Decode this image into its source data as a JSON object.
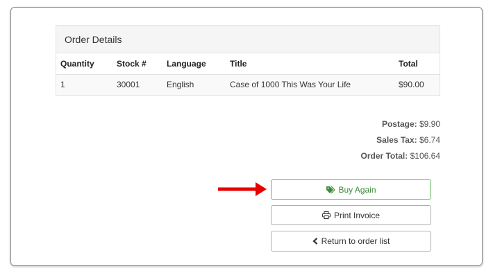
{
  "order_details": {
    "heading": "Order Details",
    "columns": [
      "Quantity",
      "Stock #",
      "Language",
      "Title",
      "Total"
    ],
    "rows": [
      [
        "1",
        "30001",
        "English",
        "Case of 1000 This Was Your Life",
        "$90.00"
      ]
    ]
  },
  "totals": {
    "postage_label": "Postage:",
    "postage_value": "$9.90",
    "tax_label": "Sales Tax:",
    "tax_value": "$6.74",
    "order_total_label": "Order Total:",
    "order_total_value": "$106.64"
  },
  "buttons": {
    "buy_again": "Buy Again",
    "print_invoice": "Print Invoice",
    "return_to_list": "Return to order list"
  },
  "colors": {
    "buy_again_border": "#5cb85c",
    "buy_again_text": "#3c8c3c",
    "arrow": "#e60000"
  },
  "icons": {
    "buy_again": "tags-icon",
    "print_invoice": "print-icon",
    "return_to_list": "chevron-left-icon",
    "annotation": "red-arrow-icon"
  }
}
